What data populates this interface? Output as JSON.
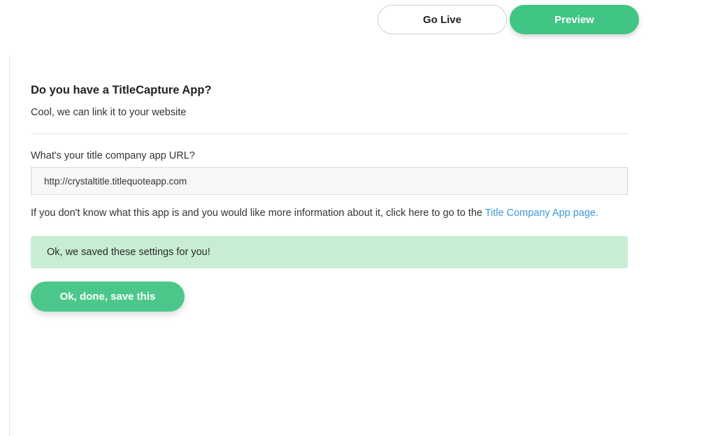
{
  "header": {
    "go_live_label": "Go Live",
    "preview_label": "Preview"
  },
  "form": {
    "heading": "Do you have a TitleCapture App?",
    "subheading": "Cool, we can link it to your website",
    "url_label": "What's your title company app URL?",
    "url_value": "http://crystaltitle.titlequoteapp.com",
    "info_text": "If you don't know what this app is and you would like more information about it, click here to go to the ",
    "info_link": "Title Company App page.",
    "success_message": "Ok, we saved these settings for you!",
    "save_label": "Ok, done, save this"
  },
  "colors": {
    "accent": "#40c584",
    "success_bg": "#c8edd2",
    "link": "#3a9ad9"
  }
}
